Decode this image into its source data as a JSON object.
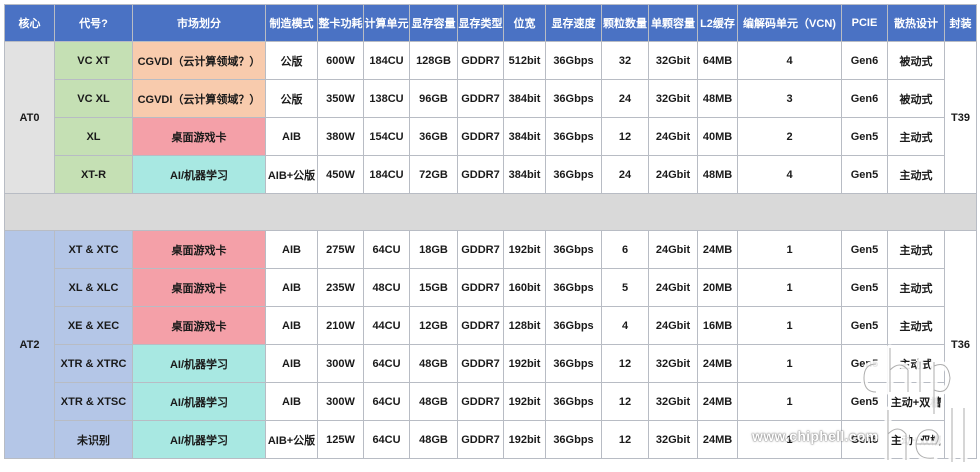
{
  "headers": [
    "核心",
    "代号?",
    "市场划分",
    "制造模式",
    "整卡功耗",
    "计算单元",
    "显存容量",
    "显存类型",
    "位宽",
    "显存速度",
    "颗粒数量",
    "单颗容量",
    "L2缓存",
    "编解码单元（VCN)",
    "PCIE",
    "散热设计",
    "封装"
  ],
  "groups": [
    {
      "core": "AT0",
      "package": "T39",
      "rows": [
        {
          "code": "VC XT",
          "market": "CGVDI（云计算领域？）",
          "market_type": "cgvdi",
          "mode": "公版",
          "power": "600W",
          "cu": "184CU",
          "mem": "128GB",
          "memtype": "GDDR7",
          "bus": "512bit",
          "speed": "36Gbps",
          "chips": "32",
          "chipcap": "32Gbit",
          "l2": "64MB",
          "vcn": "4",
          "pcie": "Gen6",
          "cooling": "被动式"
        },
        {
          "code": "VC XL",
          "market": "CGVDI（云计算领域？）",
          "market_type": "cgvdi",
          "mode": "公版",
          "power": "350W",
          "cu": "138CU",
          "mem": "96GB",
          "memtype": "GDDR7",
          "bus": "384bit",
          "speed": "36Gbps",
          "chips": "24",
          "chipcap": "32Gbit",
          "l2": "48MB",
          "vcn": "3",
          "pcie": "Gen6",
          "cooling": "被动式"
        },
        {
          "code": "XL",
          "market": "桌面游戏卡",
          "market_type": "game",
          "mode": "AIB",
          "power": "380W",
          "cu": "154CU",
          "mem": "36GB",
          "memtype": "GDDR7",
          "bus": "384bit",
          "speed": "36Gbps",
          "chips": "12",
          "chipcap": "24Gbit",
          "l2": "40MB",
          "vcn": "2",
          "pcie": "Gen5",
          "cooling": "主动式"
        },
        {
          "code": "XT-R",
          "market": "AI/机器学习",
          "market_type": "ai",
          "mode": "AIB+公版",
          "power": "450W",
          "cu": "184CU",
          "mem": "72GB",
          "memtype": "GDDR7",
          "bus": "384bit",
          "speed": "36Gbps",
          "chips": "24",
          "chipcap": "24Gbit",
          "l2": "48MB",
          "vcn": "4",
          "pcie": "Gen5",
          "cooling": "主动式"
        }
      ]
    },
    {
      "core": "AT2",
      "package": "T36",
      "rows": [
        {
          "code": "XT & XTC",
          "market": "桌面游戏卡",
          "market_type": "game",
          "mode": "AIB",
          "power": "275W",
          "cu": "64CU",
          "mem": "18GB",
          "memtype": "GDDR7",
          "bus": "192bit",
          "speed": "36Gbps",
          "chips": "6",
          "chipcap": "24Gbit",
          "l2": "24MB",
          "vcn": "1",
          "pcie": "Gen5",
          "cooling": "主动式"
        },
        {
          "code": "XL & XLC",
          "market": "桌面游戏卡",
          "market_type": "game",
          "mode": "AIB",
          "power": "235W",
          "cu": "48CU",
          "mem": "15GB",
          "memtype": "GDDR7",
          "bus": "160bit",
          "speed": "36Gbps",
          "chips": "5",
          "chipcap": "24Gbit",
          "l2": "20MB",
          "vcn": "1",
          "pcie": "Gen5",
          "cooling": "主动式"
        },
        {
          "code": "XE & XEC",
          "market": "桌面游戏卡",
          "market_type": "game",
          "mode": "AIB",
          "power": "210W",
          "cu": "44CU",
          "mem": "12GB",
          "memtype": "GDDR7",
          "bus": "128bit",
          "speed": "36Gbps",
          "chips": "4",
          "chipcap": "24Gbit",
          "l2": "16MB",
          "vcn": "1",
          "pcie": "Gen5",
          "cooling": "主动式"
        },
        {
          "code": "XTR & XTRC",
          "market": "AI/机器学习",
          "market_type": "ai",
          "mode": "AIB",
          "power": "300W",
          "cu": "64CU",
          "mem": "48GB",
          "memtype": "GDDR7",
          "bus": "192bit",
          "speed": "36Gbps",
          "chips": "12",
          "chipcap": "32Gbit",
          "l2": "24MB",
          "vcn": "1",
          "pcie": "Gen5",
          "cooling": "主动式"
        },
        {
          "code": "XTR & XTSC",
          "market": "AI/机器学习",
          "market_type": "ai",
          "mode": "AIB",
          "power": "300W",
          "cu": "64CU",
          "mem": "48GB",
          "memtype": "GDDR7",
          "bus": "192bit",
          "speed": "36Gbps",
          "chips": "12",
          "chipcap": "32Gbit",
          "l2": "24MB",
          "vcn": "1",
          "pcie": "Gen5",
          "cooling": "主动+双槽"
        },
        {
          "code": "未识别",
          "market": "AI/机器学习",
          "market_type": "ai",
          "mode": "AIB+公版",
          "power": "125W",
          "cu": "64CU",
          "mem": "48GB",
          "memtype": "GDDR7",
          "bus": "192bit",
          "speed": "36Gbps",
          "chips": "12",
          "chipcap": "32Gbit",
          "l2": "24MB",
          "vcn": "1",
          "pcie": "Gen5",
          "cooling": "主动+双槽"
        }
      ]
    }
  ],
  "watermark": {
    "logo_text": "chiphell",
    "url": "www.chiphell.com"
  },
  "colors": {
    "header": "#4a72c4",
    "game": "#f4a0a8",
    "ai": "#a8e8e2",
    "cgvdi": "#f8cbad",
    "at0_code": "#c5e0b4",
    "at2": "#b4c6e7"
  }
}
